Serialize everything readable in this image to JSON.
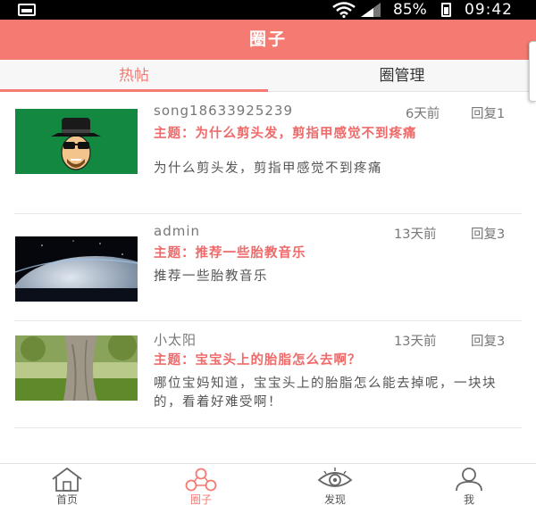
{
  "status_bar": {
    "battery": "85%",
    "time": "09:42"
  },
  "header": {
    "title": "圈子"
  },
  "tabs": [
    {
      "label": "热帖",
      "active": true
    },
    {
      "label": "圈管理",
      "active": false
    }
  ],
  "posts": [
    {
      "author": "song18633925239",
      "time": "6天前",
      "replies": "回复1",
      "subject": "主题：为什么剪头发，剪指甲感觉不到疼痛",
      "summary": "为什么剪头发，剪指甲感觉不到疼痛",
      "thumbnail": "cartoon-man-avatar"
    },
    {
      "author": "admin",
      "time": "13天前",
      "replies": "回复3",
      "subject": "主题：推荐一些胎教音乐",
      "summary": "推荐一些胎教音乐",
      "thumbnail": "planet-space-image"
    },
    {
      "author": "小太阳",
      "time": "13天前",
      "replies": "回复3",
      "subject": "主题：宝宝头上的胎脂怎么去啊？",
      "summary": "哪位宝妈知道，宝宝头上的胎脂怎么能去掉呢，一块块的，看着好难受啊！",
      "thumbnail": "tree-trunk-image"
    }
  ],
  "bottom_nav": [
    {
      "label": "首页",
      "icon": "home-icon",
      "active": false
    },
    {
      "label": "圈子",
      "icon": "circle-group-icon",
      "active": true
    },
    {
      "label": "发现",
      "icon": "eye-icon",
      "active": false
    },
    {
      "label": "我",
      "icon": "user-icon",
      "active": false
    }
  ],
  "colors": {
    "accent": "#f47a72",
    "subject": "#f06a6a"
  }
}
